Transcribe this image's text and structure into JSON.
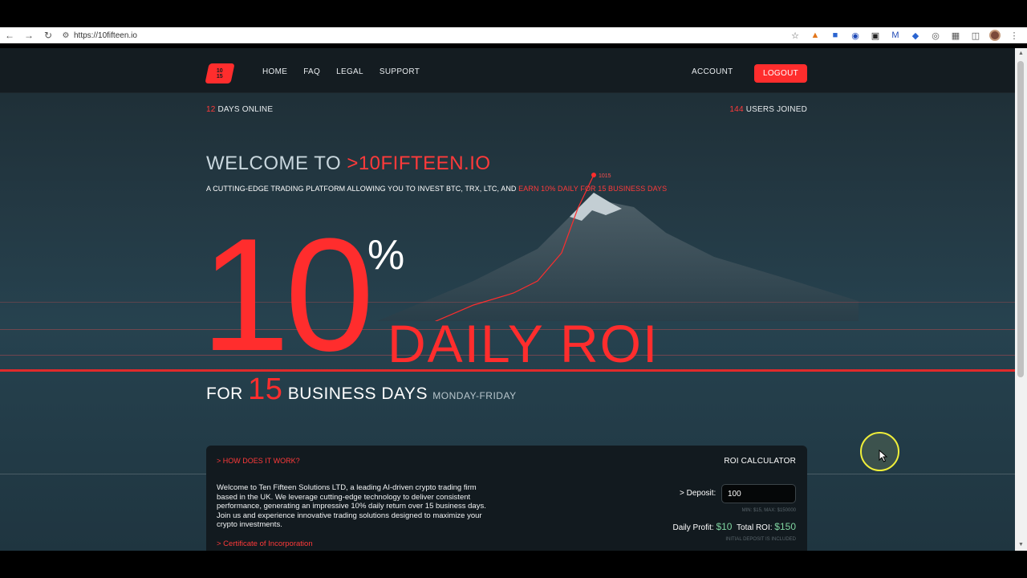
{
  "browser": {
    "url": "https://10fifteen.io"
  },
  "header": {
    "logo_text": "10\n15",
    "nav": [
      "HOME",
      "FAQ",
      "LEGAL",
      "SUPPORT"
    ],
    "account_label": "ACCOUNT",
    "logout_label": "LOGOUT"
  },
  "stats": {
    "days_online_num": "12",
    "days_online_label": " DAYS ONLINE",
    "users_joined_num": "144",
    "users_joined_label": " USERS JOINED"
  },
  "hero": {
    "welcome_prefix": "WELCOME TO ",
    "brand": ">10FIFTEEN.IO",
    "tagline_prefix": "A CUTTING-EDGE TRADING PLATFORM ALLOWING YOU TO INVEST BTC, TRX, LTC, AND ",
    "tagline_highlight": "EARN 10% DAILY FOR 15 BUSINESS DAYS",
    "peak_label": "1015",
    "big_number": "10",
    "percent": "%",
    "daily_roi": "DAILY ROI",
    "for_label": "FOR ",
    "days_number": "15",
    "business_days": " BUSINESS DAYS ",
    "weekdays": "MONDAY-FRIDAY"
  },
  "card": {
    "how_link": "> HOW DOES IT WORK?",
    "intro": "Welcome to Ten Fifteen Solutions LTD, a leading AI-driven crypto trading firm based in the UK. We leverage cutting-edge technology to deliver consistent performance, generating an impressive 10% daily return over 15 business days. Join us and experience innovative trading solutions designed to maximize your crypto investments.",
    "cert_link": "> Certificate of Incorporation",
    "roi_title": "ROI CALCULATOR",
    "deposit_label": "> Deposit:",
    "deposit_value": "100",
    "min_max": "MIN: $15, MAX: $150000",
    "daily_profit_label": "Daily Profit: ",
    "daily_profit_value": "$10",
    "total_roi_label": "Total ROI: ",
    "total_roi_value": "$150",
    "initial_note": "INITIAL DEPOSIT IS INCLUDED"
  },
  "colors": {
    "accent_red": "#ff2d2d",
    "profit_green": "#7fd4a0",
    "header_bg": "#141c21"
  }
}
